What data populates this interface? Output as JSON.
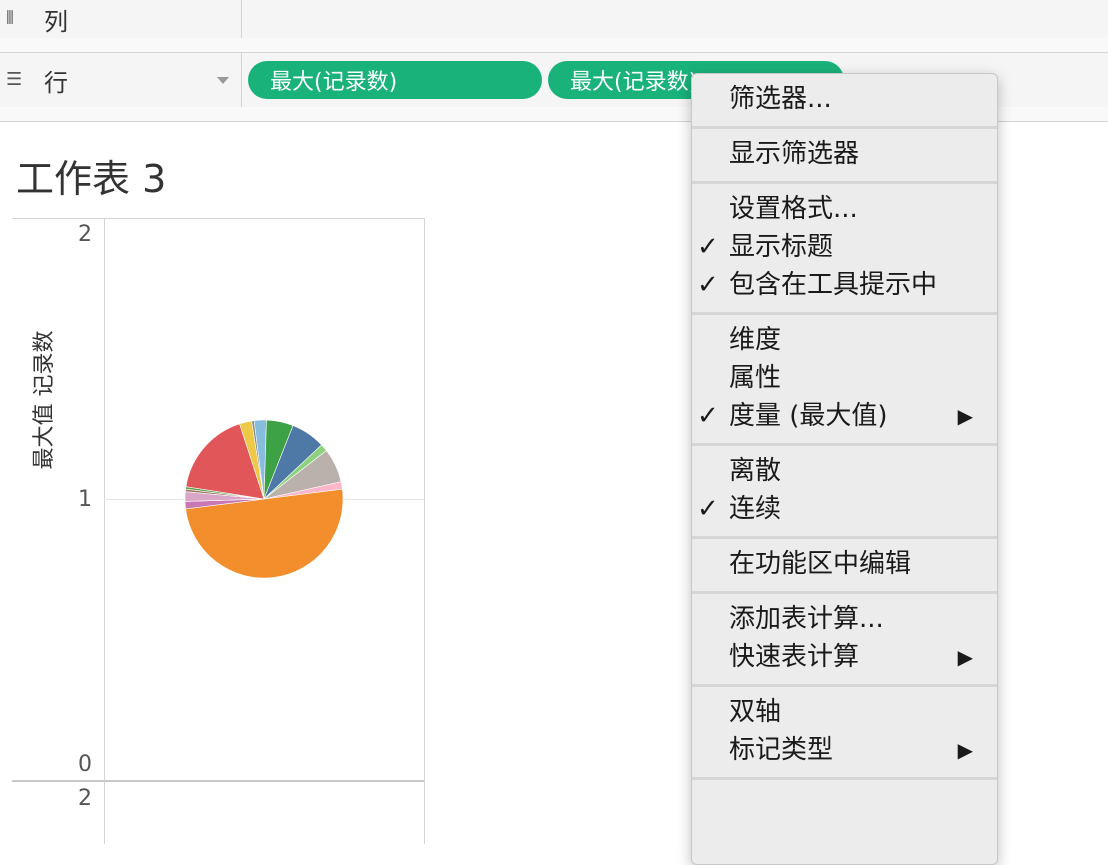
{
  "shelves": {
    "columns": {
      "icon": "columns-icon",
      "label": "列"
    },
    "rows": {
      "icon": "rows-icon",
      "label": "行",
      "pills": [
        "最大(记录数)",
        "最大(记录数)"
      ]
    }
  },
  "sheet": {
    "title": "工作表 3"
  },
  "axis": {
    "title": "最大值 记录数",
    "ticks": [
      "2",
      "1",
      "0"
    ],
    "next_pane_tick": "2"
  },
  "colors": {
    "pill": "#19b27b",
    "menu_bg": "#ececec"
  },
  "chart_data": {
    "type": "pie",
    "y_axis": {
      "label": "最大值 记录数",
      "ylim": [
        0,
        2
      ],
      "ticks": [
        0,
        1,
        2
      ]
    },
    "pie_center_y": 1,
    "slices": [
      {
        "color": "#f28e2b",
        "share": 0.5
      },
      {
        "color": "#c977b3",
        "share": 0.015
      },
      {
        "color": "#d9a6c8",
        "share": 0.02
      },
      {
        "color": "#9c755f",
        "share": 0.005
      },
      {
        "color": "#59a14f",
        "share": 0.005
      },
      {
        "color": "#e15759",
        "share": 0.175
      },
      {
        "color": "#edc948",
        "share": 0.025
      },
      {
        "color": "#8a8a8a",
        "share": 0.005
      },
      {
        "color": "#86bcdd",
        "share": 0.025
      },
      {
        "color": "#3da146",
        "share": 0.055
      },
      {
        "color": "#4e79a7",
        "share": 0.07
      },
      {
        "color": "#8cd17d",
        "share": 0.015
      },
      {
        "color": "#bab0ac",
        "share": 0.07
      },
      {
        "color": "#ffb6c8",
        "share": 0.015
      }
    ]
  },
  "menu": {
    "groups": [
      [
        {
          "label": "筛选器..."
        }
      ],
      [
        {
          "label": "显示筛选器"
        }
      ],
      [
        {
          "label": "设置格式..."
        },
        {
          "label": "显示标题",
          "checked": true
        },
        {
          "label": "包含在工具提示中",
          "checked": true
        }
      ],
      [
        {
          "label": "维度"
        },
        {
          "label": "属性"
        },
        {
          "label": "度量 (最大值)",
          "checked": true,
          "submenu": true
        }
      ],
      [
        {
          "label": "离散"
        },
        {
          "label": "连续",
          "checked": true
        }
      ],
      [
        {
          "label": "在功能区中编辑"
        }
      ],
      [
        {
          "label": "添加表计算..."
        },
        {
          "label": "快速表计算",
          "submenu": true
        }
      ],
      [
        {
          "label": "双轴"
        },
        {
          "label": "标记类型",
          "submenu": true
        }
      ]
    ],
    "check_glyph": "✓",
    "submenu_glyph": "▶"
  }
}
